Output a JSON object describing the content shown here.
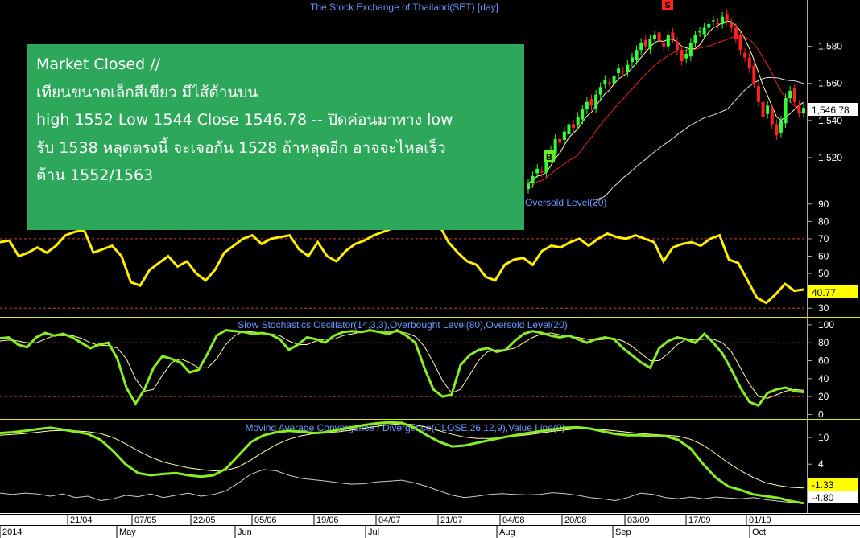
{
  "colors": {
    "background": "#000000",
    "up_candle": "#33ff33",
    "down_candle": "#ff2222",
    "rsi_line": "#ffee00",
    "stoch_fast": "#88ee22",
    "macd_line": "#88ee22",
    "panel_title": "#6699ff",
    "level_line": "#cc4444",
    "signal_buy": "#66ee22",
    "signal_sell": "#ff2222",
    "note_bg": "#2da85a"
  },
  "note": {
    "line1": "Market Closed //",
    "line2": "เทียนขนาดเล็กสีเขียว มีไส้ด้านบน",
    "line3": "high 1552 Low 1544 Close 1546.78 -- ปิดค่อนมาทาง low",
    "line4": "รับ 1538 หลุดตรงนี้ จะเจอกัน 1528 ถ้าหลุดอีก อาจจะไหลเร็ว",
    "line5": "ต้าน 1552/1563"
  },
  "chart_data": [
    {
      "type": "candlestick",
      "title": "The Stock Exchange of Thailand(SET) [day]",
      "y_ticks": [
        "1,580",
        "1,560",
        "1,540",
        "1,520"
      ],
      "ylim": [
        1500,
        1605
      ],
      "last_value": "1,546.78",
      "signals": [
        {
          "label": "B",
          "date": "2014-08-06"
        },
        {
          "label": "S",
          "date": "2014-09-08"
        }
      ],
      "visible_window": {
        "start": "2014-07-30",
        "end": "2014-10-17"
      },
      "close": [
        1506,
        1510,
        1514,
        1512,
        1518,
        1524,
        1530,
        1528,
        1534,
        1538,
        1536,
        1542,
        1546,
        1550,
        1548,
        1554,
        1558,
        1562,
        1560,
        1564,
        1568,
        1566,
        1570,
        1574,
        1578,
        1582,
        1580,
        1584,
        1586,
        1583,
        1580,
        1586,
        1584,
        1578,
        1572,
        1576,
        1582,
        1586,
        1588,
        1590,
        1592,
        1594,
        1592,
        1596,
        1594,
        1590,
        1584,
        1578,
        1574,
        1568,
        1560,
        1550,
        1542,
        1548,
        1538,
        1532,
        1540,
        1552,
        1556,
        1550,
        1544,
        1546.78
      ]
    },
    {
      "type": "line",
      "title": "Oversold Level(30)",
      "y_ticks": [
        "90",
        "80",
        "70",
        "60",
        "50",
        "40",
        "30"
      ],
      "ylim": [
        25,
        95
      ],
      "levels": [
        70,
        30
      ],
      "last_value": "40.77",
      "values": [
        68,
        69,
        60,
        62,
        65,
        62,
        66,
        72,
        74,
        75,
        62,
        64,
        66,
        60,
        45,
        43,
        52,
        56,
        60,
        54,
        57,
        50,
        46,
        52,
        62,
        66,
        70,
        72,
        67,
        70,
        71,
        72,
        64,
        60,
        68,
        60,
        57,
        63,
        67,
        69,
        72,
        74,
        76,
        79,
        82,
        83,
        84,
        78,
        68,
        62,
        57,
        55,
        48,
        46,
        55,
        58,
        59,
        55,
        63,
        66,
        65,
        68,
        70,
        66,
        70,
        73,
        71,
        70,
        72,
        70,
        68,
        57,
        65,
        67,
        68,
        66,
        70,
        72,
        58,
        56,
        46,
        36,
        33,
        38,
        44,
        40,
        40.77
      ]
    },
    {
      "type": "line",
      "title": "Slow Stochastics Oscillator(14,3,3),Overbought Level(80),Oversold Level(20)",
      "y_ticks": [
        "100",
        "80",
        "60",
        "40",
        "20",
        "0"
      ],
      "ylim": [
        -5,
        108
      ],
      "levels": [
        80,
        20
      ],
      "series": [
        {
          "values": [
            85,
            86,
            78,
            75,
            86,
            91,
            88,
            90,
            86,
            80,
            74,
            78,
            80,
            62,
            30,
            12,
            28,
            52,
            65,
            62,
            58,
            47,
            50,
            68,
            88,
            94,
            93,
            92,
            90,
            91,
            89,
            84,
            72,
            78,
            86,
            84,
            80,
            88,
            92,
            93,
            92,
            94,
            92,
            90,
            94,
            88,
            80,
            52,
            28,
            20,
            22,
            55,
            66,
            72,
            74,
            70,
            72,
            82,
            90,
            93,
            91,
            88,
            86,
            88,
            84,
            80,
            84,
            86,
            84,
            74,
            66,
            58,
            52,
            74,
            82,
            86,
            84,
            80,
            90,
            80,
            68,
            50,
            30,
            14,
            10,
            24,
            28,
            30,
            26,
            25
          ]
        },
        {
          "values": [
            82,
            83,
            82,
            80,
            80,
            84,
            88,
            88,
            88,
            85,
            80,
            77,
            77,
            74,
            62,
            40,
            26,
            28,
            44,
            58,
            62,
            58,
            52,
            52,
            62,
            78,
            88,
            93,
            92,
            91,
            90,
            88,
            82,
            78,
            78,
            82,
            84,
            84,
            88,
            90,
            92,
            93,
            92,
            92,
            92,
            91,
            87,
            76,
            58,
            38,
            24,
            28,
            44,
            60,
            70,
            72,
            72,
            74,
            80,
            86,
            90,
            91,
            89,
            87,
            86,
            84,
            83,
            84,
            85,
            82,
            76,
            68,
            60,
            60,
            68,
            78,
            84,
            83,
            84,
            84,
            80,
            70,
            52,
            34,
            20,
            18,
            22,
            26,
            28,
            27
          ]
        }
      ]
    },
    {
      "type": "line",
      "title": "Moving Average Convergence / Divergence(CLOSE,26,12,9),Value Line(0)",
      "y_ticks": [
        "10",
        "4",
        "-2"
      ],
      "ylim": [
        -7,
        14
      ],
      "last_values": [
        "-1.33",
        "-4.80"
      ],
      "series": [
        {
          "values": [
            11,
            11.2,
            11.5,
            11.9,
            12.2,
            11.8,
            11.3,
            10.8,
            9.5,
            7,
            4,
            2,
            1.5,
            1.8,
            2,
            1.5,
            1.2,
            1.5,
            3,
            6,
            9,
            10.5,
            11.2,
            11.5,
            11.3,
            11,
            11.2,
            11.8,
            12.3,
            12.8,
            13.2,
            13.4,
            13.3,
            12.2,
            10.5,
            9,
            8,
            8.2,
            8.8,
            9.4,
            10,
            10.5,
            11,
            11.4,
            11.8,
            12.2,
            12.3,
            12,
            11.4,
            10.8,
            10.5,
            10.5,
            10.3,
            10.3,
            9.5,
            7.5,
            4,
            1,
            -1,
            -1.8,
            -2.8,
            -3.2,
            -3.6,
            -4.3,
            -4.8
          ]
        },
        {
          "values": [
            10.5,
            10.7,
            10.9,
            11.2,
            11.5,
            11.6,
            11.5,
            11.3,
            10.9,
            10,
            8.6,
            7,
            5.6,
            4.5,
            3.8,
            3.2,
            2.8,
            2.5,
            2.6,
            3.4,
            5,
            6.8,
            8.4,
            9.6,
            10.4,
            10.9,
            11.1,
            11.3,
            11.7,
            12.1,
            12.5,
            12.9,
            13.1,
            12.9,
            12.3,
            11.5,
            10.7,
            10.1,
            9.8,
            9.8,
            10,
            10.3,
            10.6,
            11,
            11.4,
            11.7,
            12,
            12,
            11.8,
            11.5,
            11.2,
            10.9,
            10.7,
            10.5,
            10.3,
            9.6,
            8.3,
            6.4,
            4.3,
            2.5,
            1,
            -0.2,
            -0.8,
            -1.2,
            -1.33
          ]
        },
        {
          "values": [
            -2.5,
            -2.8,
            -2.5,
            -2.7,
            -3.2,
            -2.7,
            -3.5,
            -3.2,
            -4.2,
            -3.8,
            -3,
            -3.3,
            -2.7,
            -3.5,
            -3,
            -2.5,
            -3.2,
            -2.8,
            -2,
            -0.2,
            1.8,
            2.8,
            2.5,
            1.5,
            0.8,
            0.5,
            0.2,
            -0.2,
            -0.5,
            -0.4,
            0,
            0.2,
            0.4,
            -0.2,
            -1,
            -2,
            -3,
            -3.5,
            -3.2,
            -2.8,
            -2.6,
            -2.8,
            -2.9,
            -2.8,
            -2.4,
            -2.6,
            -3,
            -3.5,
            -3.8,
            -4.2,
            -3.5,
            -2.5,
            -2.8,
            -3.5,
            -3.8,
            -3.4,
            -3.8,
            -3.4,
            -3.6,
            -3.8,
            -3.5,
            -4,
            -4.3,
            -4.6,
            -4.8
          ]
        }
      ]
    }
  ],
  "x_axis": {
    "day_labels": [
      "21/04",
      "07/05",
      "22/05",
      "05/06",
      "19/06",
      "04/07",
      "21/07",
      "04/08",
      "20/08",
      "03/09",
      "17/09",
      "01/10"
    ],
    "month_labels": [
      "2014",
      "May",
      "Jun",
      "Jul",
      "Aug",
      "Sep",
      "Oct"
    ]
  }
}
